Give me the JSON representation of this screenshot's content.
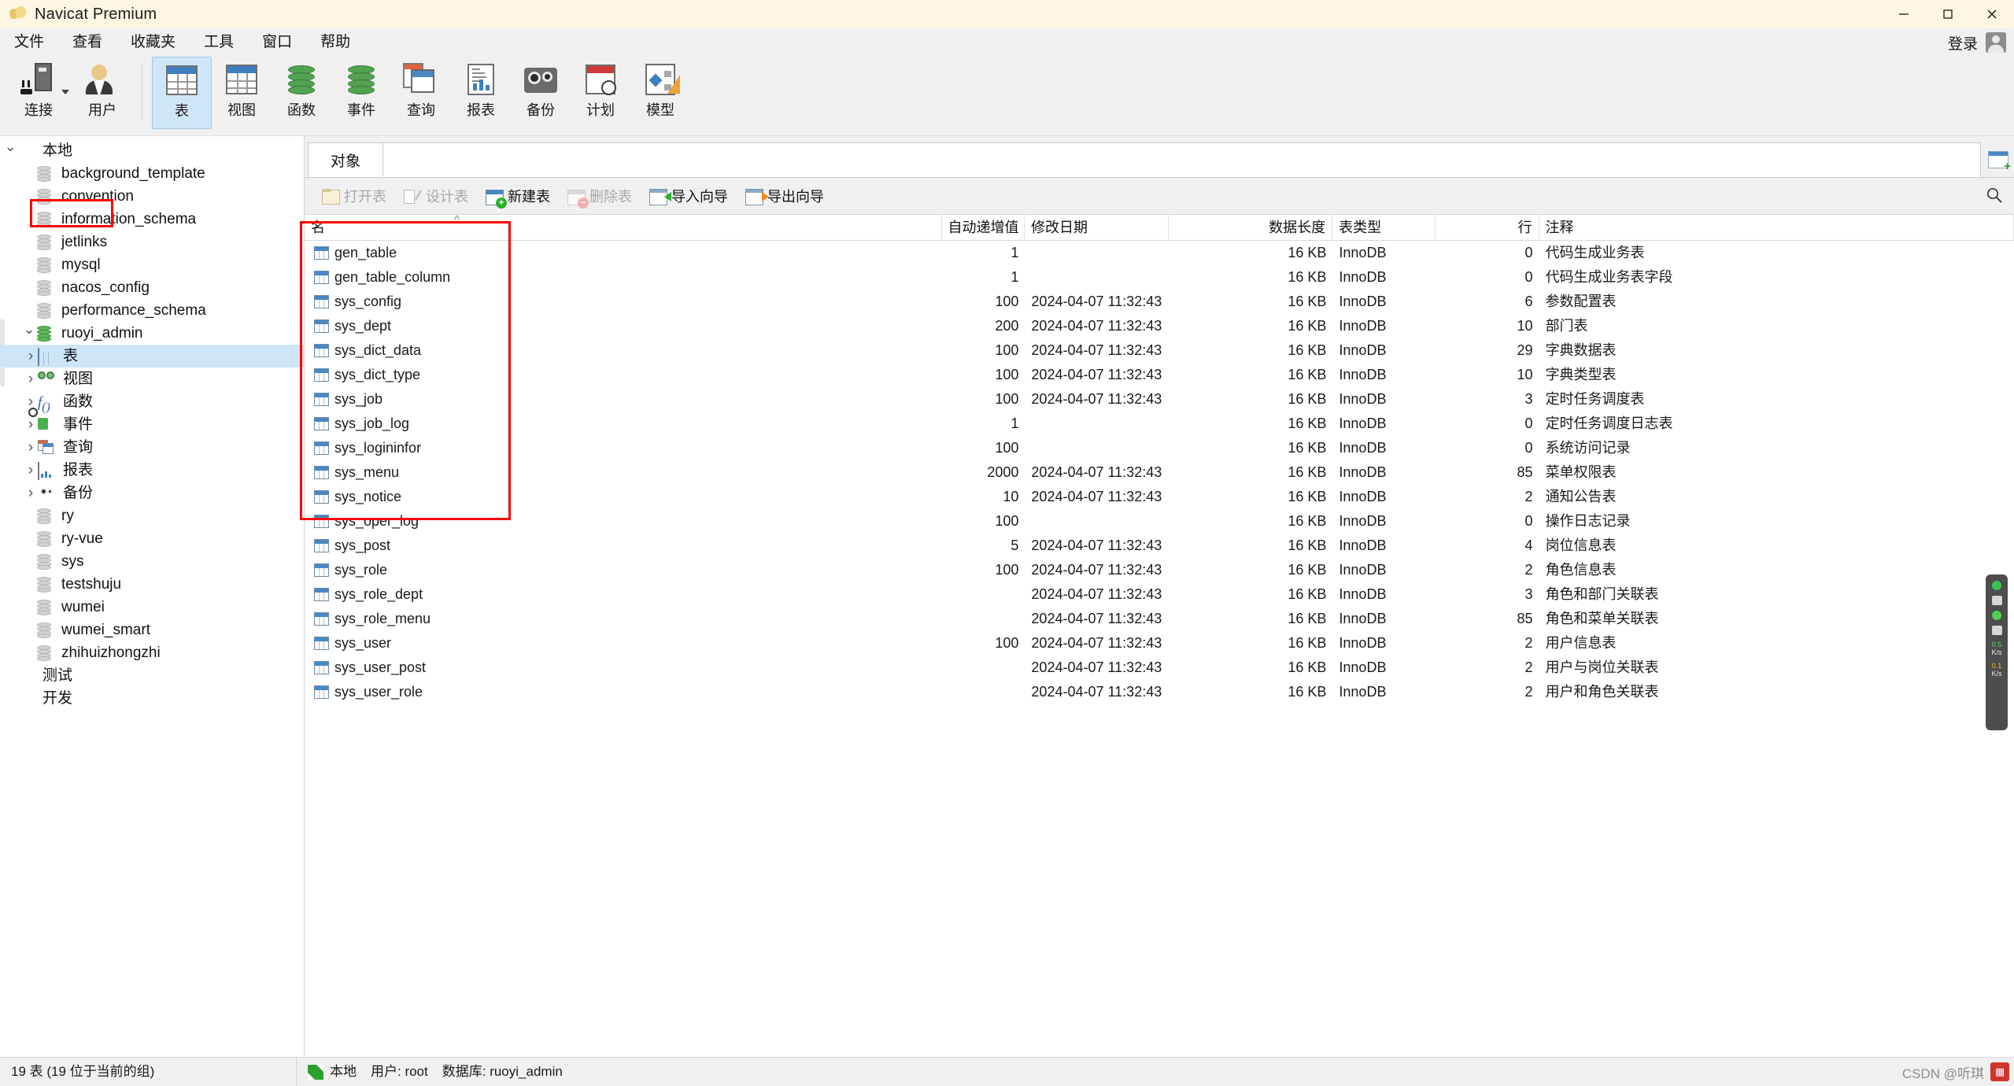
{
  "window": {
    "title": "Navicat Premium",
    "controls": {
      "minimize": "minimize-icon",
      "maximize": "maximize-icon",
      "close": "close-icon"
    }
  },
  "menubar": {
    "items": [
      "文件",
      "查看",
      "收藏夹",
      "工具",
      "窗口",
      "帮助"
    ],
    "login_label": "登录"
  },
  "toolbar": {
    "buttons": [
      {
        "label": "连接",
        "icon": "connection-icon",
        "has_dropdown": true,
        "selected": false
      },
      {
        "label": "用户",
        "icon": "user-icon",
        "has_dropdown": false,
        "selected": false
      },
      {
        "label": "表",
        "icon": "table-icon",
        "has_dropdown": false,
        "selected": true
      },
      {
        "label": "视图",
        "icon": "view-icon",
        "has_dropdown": false,
        "selected": false
      },
      {
        "label": "函数",
        "icon": "function-icon",
        "has_dropdown": false,
        "selected": false
      },
      {
        "label": "事件",
        "icon": "event-icon",
        "has_dropdown": false,
        "selected": false
      },
      {
        "label": "查询",
        "icon": "query-icon",
        "has_dropdown": false,
        "selected": false
      },
      {
        "label": "报表",
        "icon": "report-icon",
        "has_dropdown": false,
        "selected": false
      },
      {
        "label": "备份",
        "icon": "backup-icon",
        "has_dropdown": false,
        "selected": false
      },
      {
        "label": "计划",
        "icon": "schedule-icon",
        "has_dropdown": false,
        "selected": false
      },
      {
        "label": "模型",
        "icon": "model-icon",
        "has_dropdown": false,
        "selected": false
      }
    ]
  },
  "sidebar": {
    "nodes": [
      {
        "label": "本地",
        "icon": "connection-green-icon",
        "indent": 0,
        "chevron": "down",
        "selected": false
      },
      {
        "label": "background_template",
        "icon": "database-grey-icon",
        "indent": 1,
        "chevron": "none",
        "selected": false
      },
      {
        "label": "convention",
        "icon": "database-grey-icon",
        "indent": 1,
        "chevron": "none",
        "selected": false
      },
      {
        "label": "information_schema",
        "icon": "database-grey-icon",
        "indent": 1,
        "chevron": "none",
        "selected": false
      },
      {
        "label": "jetlinks",
        "icon": "database-grey-icon",
        "indent": 1,
        "chevron": "none",
        "selected": false
      },
      {
        "label": "mysql",
        "icon": "database-grey-icon",
        "indent": 1,
        "chevron": "none",
        "selected": false
      },
      {
        "label": "nacos_config",
        "icon": "database-grey-icon",
        "indent": 1,
        "chevron": "none",
        "selected": false
      },
      {
        "label": "performance_schema",
        "icon": "database-grey-icon",
        "indent": 1,
        "chevron": "none",
        "selected": false
      },
      {
        "label": "ruoyi_admin",
        "icon": "database-green-icon",
        "indent": 1,
        "chevron": "down",
        "selected": false
      },
      {
        "label": "表",
        "icon": "table-icon",
        "indent": 2,
        "chevron": "right",
        "selected": true
      },
      {
        "label": "视图",
        "icon": "view-icon",
        "indent": 2,
        "chevron": "right",
        "selected": false
      },
      {
        "label": "函数",
        "icon": "function-icon",
        "indent": 2,
        "chevron": "right",
        "selected": false
      },
      {
        "label": "事件",
        "icon": "event-icon",
        "indent": 2,
        "chevron": "right",
        "selected": false
      },
      {
        "label": "查询",
        "icon": "query-icon",
        "indent": 2,
        "chevron": "right",
        "selected": false
      },
      {
        "label": "报表",
        "icon": "report-icon",
        "indent": 2,
        "chevron": "right",
        "selected": false
      },
      {
        "label": "备份",
        "icon": "backup-icon",
        "indent": 2,
        "chevron": "right",
        "selected": false
      },
      {
        "label": "ry",
        "icon": "database-grey-icon",
        "indent": 1,
        "chevron": "none",
        "selected": false
      },
      {
        "label": "ry-vue",
        "icon": "database-grey-icon",
        "indent": 1,
        "chevron": "none",
        "selected": false
      },
      {
        "label": "sys",
        "icon": "database-grey-icon",
        "indent": 1,
        "chevron": "none",
        "selected": false
      },
      {
        "label": "testshuju",
        "icon": "database-grey-icon",
        "indent": 1,
        "chevron": "none",
        "selected": false
      },
      {
        "label": "wumei",
        "icon": "database-grey-icon",
        "indent": 1,
        "chevron": "none",
        "selected": false
      },
      {
        "label": "wumei_smart",
        "icon": "database-grey-icon",
        "indent": 1,
        "chevron": "none",
        "selected": false
      },
      {
        "label": "zhihuizhongzhi",
        "icon": "database-grey-icon",
        "indent": 1,
        "chevron": "none",
        "selected": false
      },
      {
        "label": "测试",
        "icon": "connection-grey-icon",
        "indent": 0,
        "chevron": "none",
        "selected": false
      },
      {
        "label": "开发",
        "icon": "connection-grey-icon",
        "indent": 0,
        "chevron": "none",
        "selected": false
      }
    ]
  },
  "tabs": {
    "active": "对象"
  },
  "objectbar": {
    "buttons": [
      {
        "label": "打开表",
        "icon": "open-table-icon",
        "disabled": true
      },
      {
        "label": "设计表",
        "icon": "design-table-icon",
        "disabled": true
      },
      {
        "label": "新建表",
        "icon": "new-table-icon",
        "disabled": false
      },
      {
        "label": "删除表",
        "icon": "delete-table-icon",
        "disabled": true
      },
      {
        "label": "导入向导",
        "icon": "import-wizard-icon",
        "disabled": false
      },
      {
        "label": "导出向导",
        "icon": "export-wizard-icon",
        "disabled": false
      }
    ],
    "search_icon": "search-icon"
  },
  "grid": {
    "columns": [
      "名",
      "自动递增值",
      "修改日期",
      "数据长度",
      "表类型",
      "行",
      "注释"
    ],
    "sort_column": "名",
    "rows": [
      {
        "name": "gen_table",
        "auto_increment": "1",
        "modified": "",
        "data_length": "16 KB",
        "engine": "InnoDB",
        "rows": "0",
        "comment": "代码生成业务表"
      },
      {
        "name": "gen_table_column",
        "auto_increment": "1",
        "modified": "",
        "data_length": "16 KB",
        "engine": "InnoDB",
        "rows": "0",
        "comment": "代码生成业务表字段"
      },
      {
        "name": "sys_config",
        "auto_increment": "100",
        "modified": "2024-04-07 11:32:43",
        "data_length": "16 KB",
        "engine": "InnoDB",
        "rows": "6",
        "comment": "参数配置表"
      },
      {
        "name": "sys_dept",
        "auto_increment": "200",
        "modified": "2024-04-07 11:32:43",
        "data_length": "16 KB",
        "engine": "InnoDB",
        "rows": "10",
        "comment": "部门表"
      },
      {
        "name": "sys_dict_data",
        "auto_increment": "100",
        "modified": "2024-04-07 11:32:43",
        "data_length": "16 KB",
        "engine": "InnoDB",
        "rows": "29",
        "comment": "字典数据表"
      },
      {
        "name": "sys_dict_type",
        "auto_increment": "100",
        "modified": "2024-04-07 11:32:43",
        "data_length": "16 KB",
        "engine": "InnoDB",
        "rows": "10",
        "comment": "字典类型表"
      },
      {
        "name": "sys_job",
        "auto_increment": "100",
        "modified": "2024-04-07 11:32:43",
        "data_length": "16 KB",
        "engine": "InnoDB",
        "rows": "3",
        "comment": "定时任务调度表"
      },
      {
        "name": "sys_job_log",
        "auto_increment": "1",
        "modified": "",
        "data_length": "16 KB",
        "engine": "InnoDB",
        "rows": "0",
        "comment": "定时任务调度日志表"
      },
      {
        "name": "sys_logininfor",
        "auto_increment": "100",
        "modified": "",
        "data_length": "16 KB",
        "engine": "InnoDB",
        "rows": "0",
        "comment": "系统访问记录"
      },
      {
        "name": "sys_menu",
        "auto_increment": "2000",
        "modified": "2024-04-07 11:32:43",
        "data_length": "16 KB",
        "engine": "InnoDB",
        "rows": "85",
        "comment": "菜单权限表"
      },
      {
        "name": "sys_notice",
        "auto_increment": "10",
        "modified": "2024-04-07 11:32:43",
        "data_length": "16 KB",
        "engine": "InnoDB",
        "rows": "2",
        "comment": "通知公告表"
      },
      {
        "name": "sys_oper_log",
        "auto_increment": "100",
        "modified": "",
        "data_length": "16 KB",
        "engine": "InnoDB",
        "rows": "0",
        "comment": "操作日志记录"
      },
      {
        "name": "sys_post",
        "auto_increment": "5",
        "modified": "2024-04-07 11:32:43",
        "data_length": "16 KB",
        "engine": "InnoDB",
        "rows": "4",
        "comment": "岗位信息表"
      },
      {
        "name": "sys_role",
        "auto_increment": "100",
        "modified": "2024-04-07 11:32:43",
        "data_length": "16 KB",
        "engine": "InnoDB",
        "rows": "2",
        "comment": "角色信息表"
      },
      {
        "name": "sys_role_dept",
        "auto_increment": "",
        "modified": "2024-04-07 11:32:43",
        "data_length": "16 KB",
        "engine": "InnoDB",
        "rows": "3",
        "comment": "角色和部门关联表"
      },
      {
        "name": "sys_role_menu",
        "auto_increment": "",
        "modified": "2024-04-07 11:32:43",
        "data_length": "16 KB",
        "engine": "InnoDB",
        "rows": "85",
        "comment": "角色和菜单关联表"
      },
      {
        "name": "sys_user",
        "auto_increment": "100",
        "modified": "2024-04-07 11:32:43",
        "data_length": "16 KB",
        "engine": "InnoDB",
        "rows": "2",
        "comment": "用户信息表"
      },
      {
        "name": "sys_user_post",
        "auto_increment": "",
        "modified": "2024-04-07 11:32:43",
        "data_length": "16 KB",
        "engine": "InnoDB",
        "rows": "2",
        "comment": "用户与岗位关联表"
      },
      {
        "name": "sys_user_role",
        "auto_increment": "",
        "modified": "2024-04-07 11:32:43",
        "data_length": "16 KB",
        "engine": "InnoDB",
        "rows": "2",
        "comment": "用户和角色关联表"
      }
    ]
  },
  "statusbar": {
    "count_text": "19 表 (19 位于当前的组)",
    "connection": "本地",
    "user": "用户: root",
    "database": "数据库: ruoyi_admin",
    "watermark": "CSDN @听琪"
  },
  "float_widget": {
    "upload_speed": "0.5",
    "upload_unit": "K/s",
    "download_speed": "0.1",
    "download_unit": "K/s"
  },
  "colors": {
    "accent": "#4a87c4",
    "selection": "#cde5f8",
    "annotation": "#ff0000",
    "titlebar": "#fdf6e3"
  }
}
